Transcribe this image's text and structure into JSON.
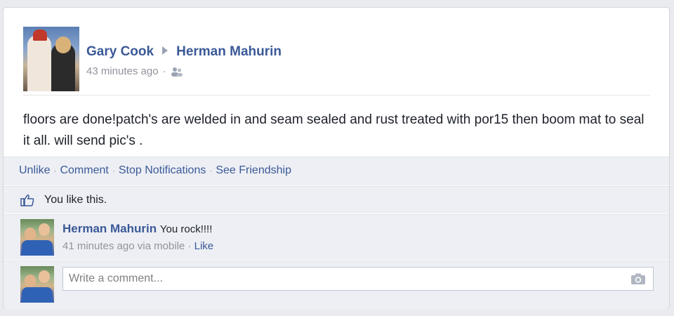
{
  "post": {
    "author": "Gary Cook",
    "target": "Herman Mahurin",
    "time": "43 minutes ago",
    "dot": "·",
    "audience_icon": "friends-icon",
    "text": "floors are done!patch's are welded in and seam sealed and rust treated with por15 then boom mat to seal it all. will send pic's ."
  },
  "actions": {
    "unlike": "Unlike",
    "comment": "Comment",
    "stop_notifications": "Stop Notifications",
    "see_friendship": "See Friendship",
    "sep": "·"
  },
  "likes": {
    "icon": "thumbs-up-icon",
    "text": "You like this."
  },
  "comments": [
    {
      "author": "Herman Mahurin",
      "text": "You rock!!!!",
      "time": "41 minutes ago via mobile",
      "sep": "·",
      "like_label": "Like"
    }
  ],
  "composer": {
    "placeholder": "Write a comment...",
    "icon": "camera-icon"
  },
  "colors": {
    "link": "#3b5998",
    "background": "#edeff4",
    "meta": "#90949c"
  }
}
